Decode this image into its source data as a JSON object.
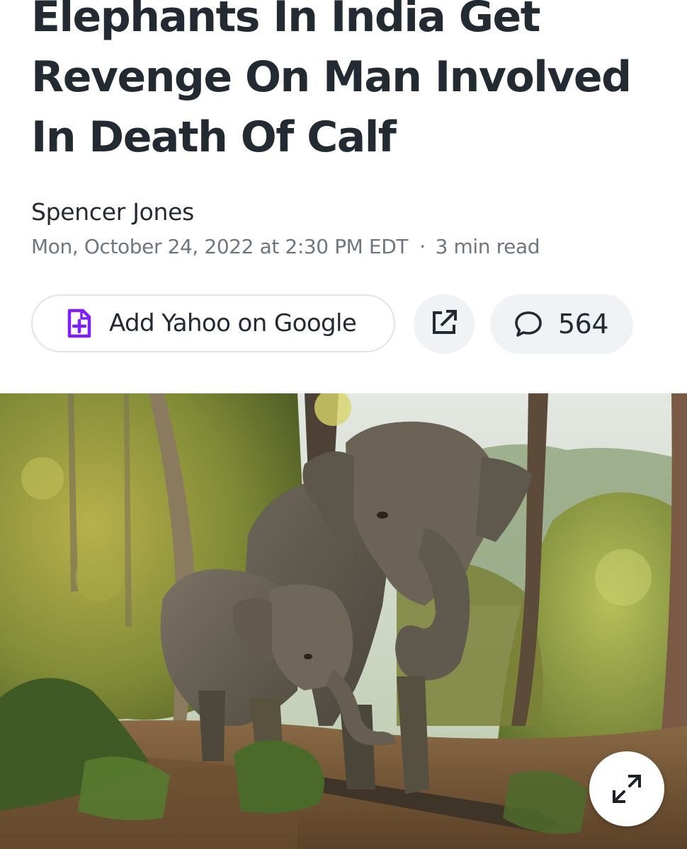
{
  "article": {
    "headline": "Elephants In India Get Revenge On Man Involved In Death Of Calf",
    "author": "Spencer Jones",
    "date": "Mon, October 24, 2022 at 2:30 PM EDT",
    "separator": "·",
    "read_time": "3 min read"
  },
  "actions": {
    "add_google_label": "Add Yahoo on Google",
    "add_google_icon": "document-plus-icon",
    "share_icon": "external-link-icon",
    "comment_icon": "speech-bubble-icon",
    "comment_count": "564"
  },
  "hero": {
    "image_subject": "Adult elephant and calf walking through a dry forest",
    "expand_icon": "expand-arrows-icon"
  },
  "colors": {
    "text_primary": "#232a31",
    "text_secondary": "#6e7780",
    "accent_purple": "#7e1fff",
    "button_bg": "#f0f3f5",
    "button_border": "#e0e4e9"
  }
}
